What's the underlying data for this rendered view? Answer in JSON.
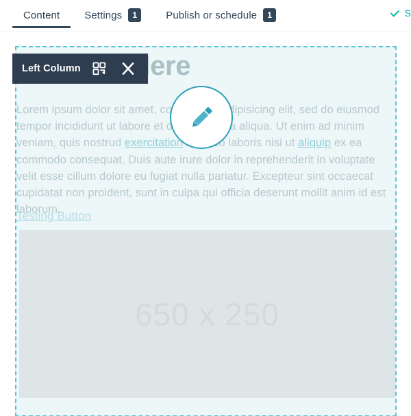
{
  "tabbar": {
    "tabs": [
      {
        "label": "Content",
        "badge": null,
        "active": true
      },
      {
        "label": "Settings",
        "badge": "1",
        "active": false
      },
      {
        "label": "Publish or schedule",
        "badge": "1",
        "active": false
      }
    ],
    "status": {
      "icon": "check-icon",
      "text": "S"
    }
  },
  "module_toolbar": {
    "title": "Left Column",
    "clone_icon": "clone-icon",
    "close_icon": "close-icon"
  },
  "module": {
    "heading": "Heading Here",
    "paragraph_parts": [
      {
        "text": "Lorem ipsum dolor sit amet, consectetur adipisicing elit, sed do eiusmod tempor incididunt ut labore et dolore magna aliqua. Ut enim ad minim veniam, quis nostrud ",
        "link": false
      },
      {
        "text": "exercitation",
        "link": true
      },
      {
        "text": " ullamco laboris nisi ut ",
        "link": false
      },
      {
        "text": "aliquip",
        "link": true
      },
      {
        "text": " ex ea commodo consequat. Duis aute irure dolor in reprehenderit in voluptate velit esse cillum dolore eu fugiat nulla pariatur. Excepteur sint occaecat cupidatat non proident, sunt in culpa qui officia deserunt mollit anim id est laborum.",
        "link": false
      }
    ],
    "button_link": "Testing Button",
    "image_placeholder_label": "650 x 250"
  },
  "edit_fab": {
    "icon": "pencil-icon"
  },
  "colors": {
    "toolbar_bg": "#2e3e50",
    "badge_bg": "#33475b",
    "accent_teal": "#00a4bd",
    "selection_border": "#55c6d8",
    "module_bg": "#eef7f8",
    "heading_text": "#a9c0c4",
    "body_text": "#b6c9cd",
    "link_text": "#8fd0da",
    "image_placeholder_bg": "#dee5e6",
    "image_placeholder_text": "#d2dbdc",
    "fab_border": "#2a9fb8",
    "check_green": "#00bda5"
  }
}
